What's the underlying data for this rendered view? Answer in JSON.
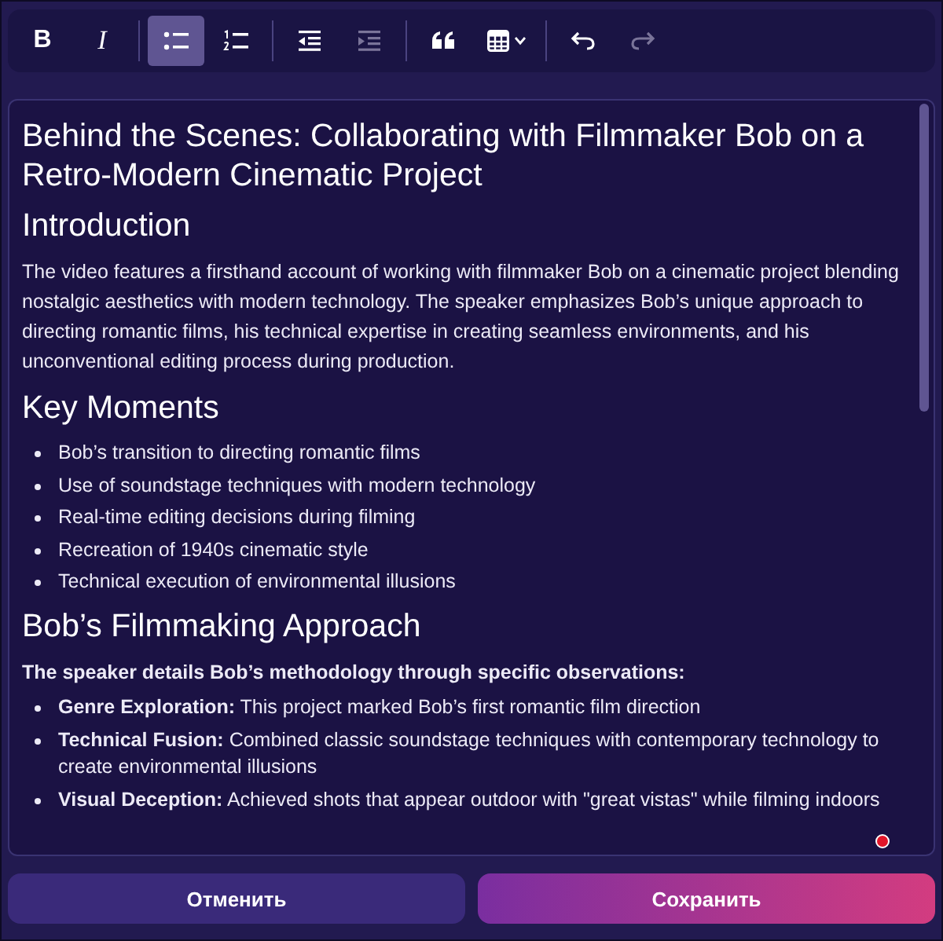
{
  "toolbar": [
    {
      "kind": "bold",
      "label": "B",
      "selected": false,
      "disabled": false
    },
    {
      "kind": "italic",
      "label": "I",
      "selected": false,
      "disabled": false
    },
    {
      "kind": "separator"
    },
    {
      "kind": "bullet-list",
      "selected": true,
      "disabled": false
    },
    {
      "kind": "ordered-list",
      "selected": false,
      "disabled": false
    },
    {
      "kind": "separator"
    },
    {
      "kind": "outdent",
      "selected": false,
      "disabled": false
    },
    {
      "kind": "indent",
      "selected": false,
      "disabled": true
    },
    {
      "kind": "separator"
    },
    {
      "kind": "quote",
      "selected": false,
      "disabled": false
    },
    {
      "kind": "table",
      "selected": false,
      "disabled": false
    },
    {
      "kind": "separator"
    },
    {
      "kind": "undo",
      "selected": false,
      "disabled": false
    },
    {
      "kind": "redo",
      "selected": false,
      "disabled": true
    }
  ],
  "editor": {
    "blocks": [
      {
        "kind": "h1",
        "text": "Behind the Scenes: Collaborating with Filmmaker Bob on a Retro-Modern Cinematic Project"
      },
      {
        "kind": "h2",
        "text": "Introduction"
      },
      {
        "kind": "p",
        "text": "The video features a firsthand account of working with filmmaker Bob on a cinematic project blending nostalgic aesthetics with modern technology. The speaker emphasizes Bob’s unique approach to directing romantic films, his technical expertise in creating seamless environments, and his unconventional editing process during production."
      },
      {
        "kind": "h2",
        "text": "Key Moments"
      },
      {
        "kind": "ul",
        "items": [
          "Bob’s transition to directing romantic films",
          "Use of soundstage techniques with modern technology",
          "Real-time editing decisions during filming",
          "Recreation of 1940s cinematic style",
          "Technical execution of environmental illusions"
        ]
      },
      {
        "kind": "h2",
        "text": "Bob’s Filmmaking Approach"
      },
      {
        "kind": "p-strong",
        "text": "The speaker details Bob’s methodology through specific observations:"
      },
      {
        "kind": "ul",
        "items": [
          "**Genre Exploration:** This project marked Bob’s first romantic film direction",
          "**Technical Fusion:** Combined classic soundstage techniques with contemporary technology to create environmental illusions",
          "**Visual Deception:** Achieved shots that appear outdoor with \"great vistas\" while filming indoors"
        ]
      }
    ],
    "unsaved": true
  },
  "buttons": [
    {
      "kind": "secondary",
      "label": "Отменить"
    },
    {
      "kind": "primary",
      "label": "Сохранить"
    }
  ]
}
